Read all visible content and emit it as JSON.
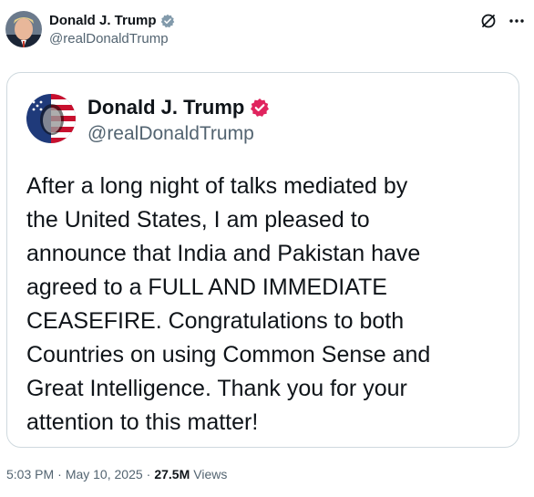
{
  "header": {
    "name": "Donald J. Trump",
    "handle": "@realDonaldTrump"
  },
  "embedded_post": {
    "name": "Donald J. Trump",
    "handle": "@realDonaldTrump",
    "text": "After a long night of talks mediated by\nthe United States, I am pleased to\nannounce that India and Pakistan have\nagreed to a FULL AND IMMEDIATE\nCEASEFIRE. Congratulations to both\nCountries on using Common Sense and\nGreat Intelligence. Thank you for your\nattention to this matter!"
  },
  "meta": {
    "time": "5:03 PM",
    "sep1": "·",
    "date": "May 10, 2025",
    "sep2": "·",
    "views_count": "27.5M",
    "views_label": "Views"
  },
  "icons": {
    "verified": "verified-badge-icon",
    "grok": "grok-icon",
    "more": "more-options-icon"
  },
  "colors": {
    "verified_blue": "#1d9bf0",
    "verified_red": "#e0245e",
    "text_secondary": "#536471",
    "border": "#cfd9de"
  }
}
